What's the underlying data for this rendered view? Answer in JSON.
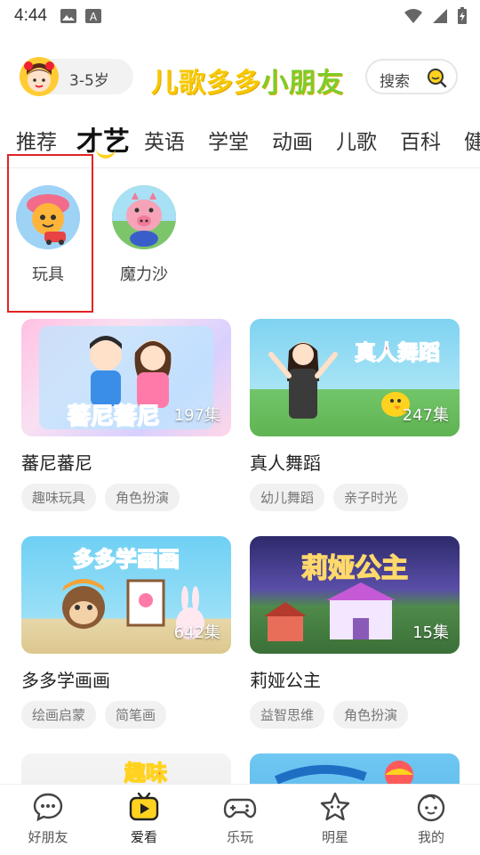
{
  "status_bar": {
    "time": "4:44"
  },
  "header": {
    "age_label": "3-5岁",
    "app_title_part1": "儿歌多多",
    "app_title_part2": "小朋友",
    "search_label": "搜索"
  },
  "tabs": [
    {
      "label": "推荐"
    },
    {
      "label": "才艺",
      "active": true
    },
    {
      "label": "英语"
    },
    {
      "label": "学堂"
    },
    {
      "label": "动画"
    },
    {
      "label": "儿歌"
    },
    {
      "label": "百科"
    },
    {
      "label": "健"
    }
  ],
  "categories": [
    {
      "label": "玩具",
      "icon": "toy-tiger-icon",
      "highlighted": true
    },
    {
      "label": "魔力沙",
      "icon": "pink-pig-icon"
    }
  ],
  "cards": [
    {
      "title": "蕃尼蕃尼",
      "count": "197集",
      "tags": [
        "趣味玩具",
        "角色扮演"
      ],
      "art": "蕃尼蕃尼"
    },
    {
      "title": "真人舞蹈",
      "count": "247集",
      "tags": [
        "幼儿舞蹈",
        "亲子时光"
      ],
      "art": "真人舞蹈"
    },
    {
      "title": "多多学画画",
      "count": "642集",
      "tags": [
        "绘画启蒙",
        "简笔画"
      ],
      "art": "多多学画画"
    },
    {
      "title": "莉娅公主",
      "count": "15集",
      "tags": [
        "益智思维",
        "角色扮演"
      ],
      "art": "莉娅公主"
    },
    {
      "title": "",
      "count": "",
      "tags": [],
      "art": "趣味"
    },
    {
      "title": "",
      "count": "",
      "tags": [],
      "art": ""
    }
  ],
  "bottom_nav": [
    {
      "label": "好朋友",
      "icon": "chat-bubble-icon"
    },
    {
      "label": "爱看",
      "icon": "tv-icon",
      "active": true
    },
    {
      "label": "乐玩",
      "icon": "gamepad-icon"
    },
    {
      "label": "明星",
      "icon": "star-icon"
    },
    {
      "label": "我的",
      "icon": "kid-face-icon"
    }
  ],
  "colors": {
    "accent_yellow": "#ffd21f",
    "title_green": "#7ccd2c",
    "highlight_red": "#e02424"
  }
}
